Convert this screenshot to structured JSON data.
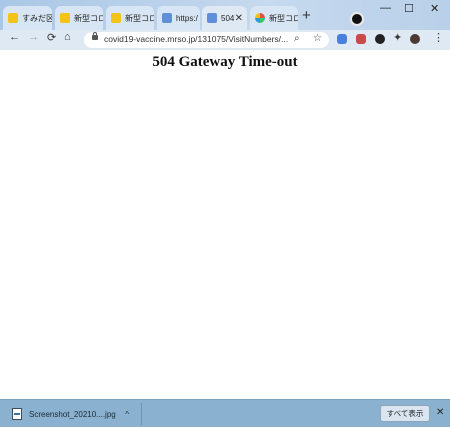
{
  "tabs": [
    {
      "title": "すみだ区",
      "favicon": "yellow-favicon"
    },
    {
      "title": "新型コロ",
      "favicon": "yellow-favicon"
    },
    {
      "title": "新型コロ",
      "favicon": "yellow-favicon"
    },
    {
      "title": "https:/",
      "favicon": "gear-favicon"
    },
    {
      "title": "504",
      "favicon": "gear-favicon",
      "active": true
    },
    {
      "title": "新型コロ",
      "favicon": "multicolor-favicon"
    }
  ],
  "toolbar": {
    "url": "covid19-vaccine.mrso.jp/131075/VisitNumbers/..."
  },
  "page": {
    "error_title": "504 Gateway Time-out"
  },
  "download_shelf": {
    "filename": "Screenshot_20210....jpg",
    "show_all_label": "すべて表示"
  },
  "colors": {
    "tabbar": "#b9d0ea",
    "toolbar": "#dfe9f3",
    "shelf": "#8ab1cf"
  }
}
